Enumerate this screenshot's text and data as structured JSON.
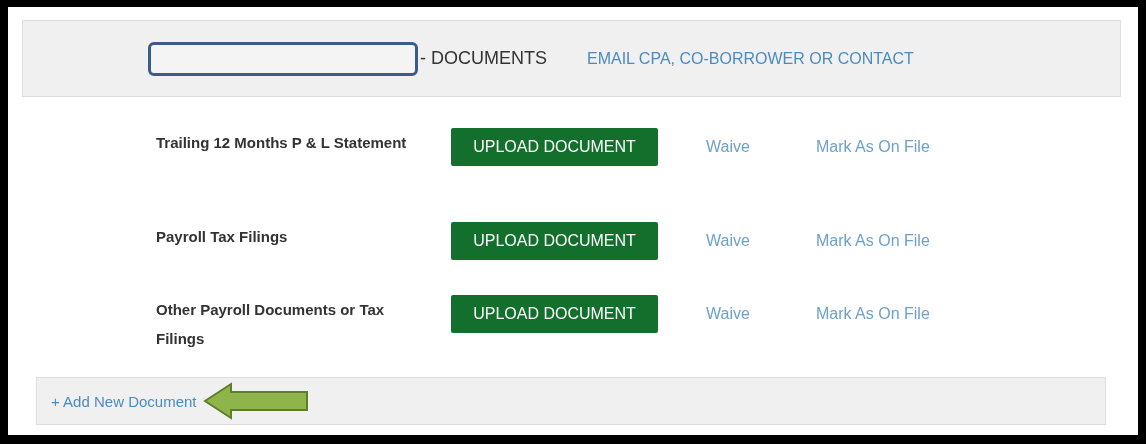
{
  "header": {
    "title": "- DOCUMENTS",
    "email_link": "EMAIL CPA, CO-BORROWER OR CONTACT"
  },
  "documents": [
    {
      "name": "Trailing 12 Months P & L Statement",
      "upload": "UPLOAD DOCUMENT",
      "waive": "Waive",
      "mark_on_file": "Mark As On File"
    },
    {
      "name": "Payroll Tax Filings",
      "upload": "UPLOAD DOCUMENT",
      "waive": "Waive",
      "mark_on_file": "Mark As On File"
    },
    {
      "name": "Other Payroll Documents or Tax Filings",
      "upload": "UPLOAD DOCUMENT",
      "waive": "Waive",
      "mark_on_file": "Mark As On File"
    }
  ],
  "footer": {
    "add_link": "+ Add New Document"
  }
}
